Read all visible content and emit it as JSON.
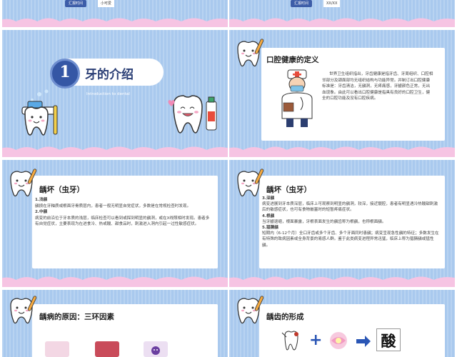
{
  "slides": {
    "top_left": {
      "badge": "汇报时间",
      "badge_value": "小可爱"
    },
    "top_right": {
      "badge": "汇报时间",
      "badge_value": "XX/XX"
    },
    "title_slide": {
      "number": "1",
      "title": "牙的介绍",
      "subtitle": "Introduction to dental"
    },
    "definition": {
      "heading": "口腔健康的定义",
      "text": "世界卫生组织指出，牙齿健康是指牙齿、牙周组织、口腔相邻部分及颌面部均无组织结构与功能异常。并制订出口腔健康标准是：牙齿清洁，无龋洞，无疼痛感，牙龈颜色正常，无出血现象。由此可以看出口腔健康是指具有良好的口腔卫生，健全的口腔功能及没有口腔疾病。"
    },
    "caries1": {
      "heading": "龋坏（虫牙）",
      "paragraphs": [
        "1.浅龋",
        "龋损在牙釉质或根面牙骨质层内，患者一般无明显自觉症状，多数是在常规检查时发现。",
        "2.中龋",
        "病变的前沿位于牙本质的浅层，临床检查可以看到或探到明显的龋洞，或在X线照相时发现。患者多有自觉症状，主要表现为在进食冷、热或酸、甜食品时，刺激进入洞内引起一过性敏感症状。"
      ]
    },
    "caries2": {
      "heading": "龋坏（虫牙）",
      "paragraphs": [
        "3.深龋",
        "病变进展到牙本质深层，临床上可观察到明显的龋洞，较深，接近髓腔，患者有明显遇冷热酸甜刺激后的敏感症状，也可有食物嵌塞时的短暂疼痛症状。",
        "4.根龋",
        "当牙龈退缩，根面暴露，牙根表面发生的龋齿称为根龋，也称根面龋。",
        "5.猖獗龋",
        "短期内（6-12个月）全口牙齿或多个牙齿、多个牙面同时患龋；病变呈现急性龋的特征；多数发生在有特殊的致病因素或全身背景的易感人群。鉴于此类病变进程异常迅猛，临床上称为猖獗龋或猛性龋。"
      ]
    },
    "causes": {
      "heading": "龋病的原因：三环因素"
    },
    "formation": {
      "heading": "龋齿的形成",
      "plus": "+",
      "acid": "酸"
    }
  },
  "colors": {
    "background": "#a9c9ee",
    "cloud": "#f6c4e3",
    "accent_blue": "#3557a5",
    "panel": "#ffffff"
  }
}
